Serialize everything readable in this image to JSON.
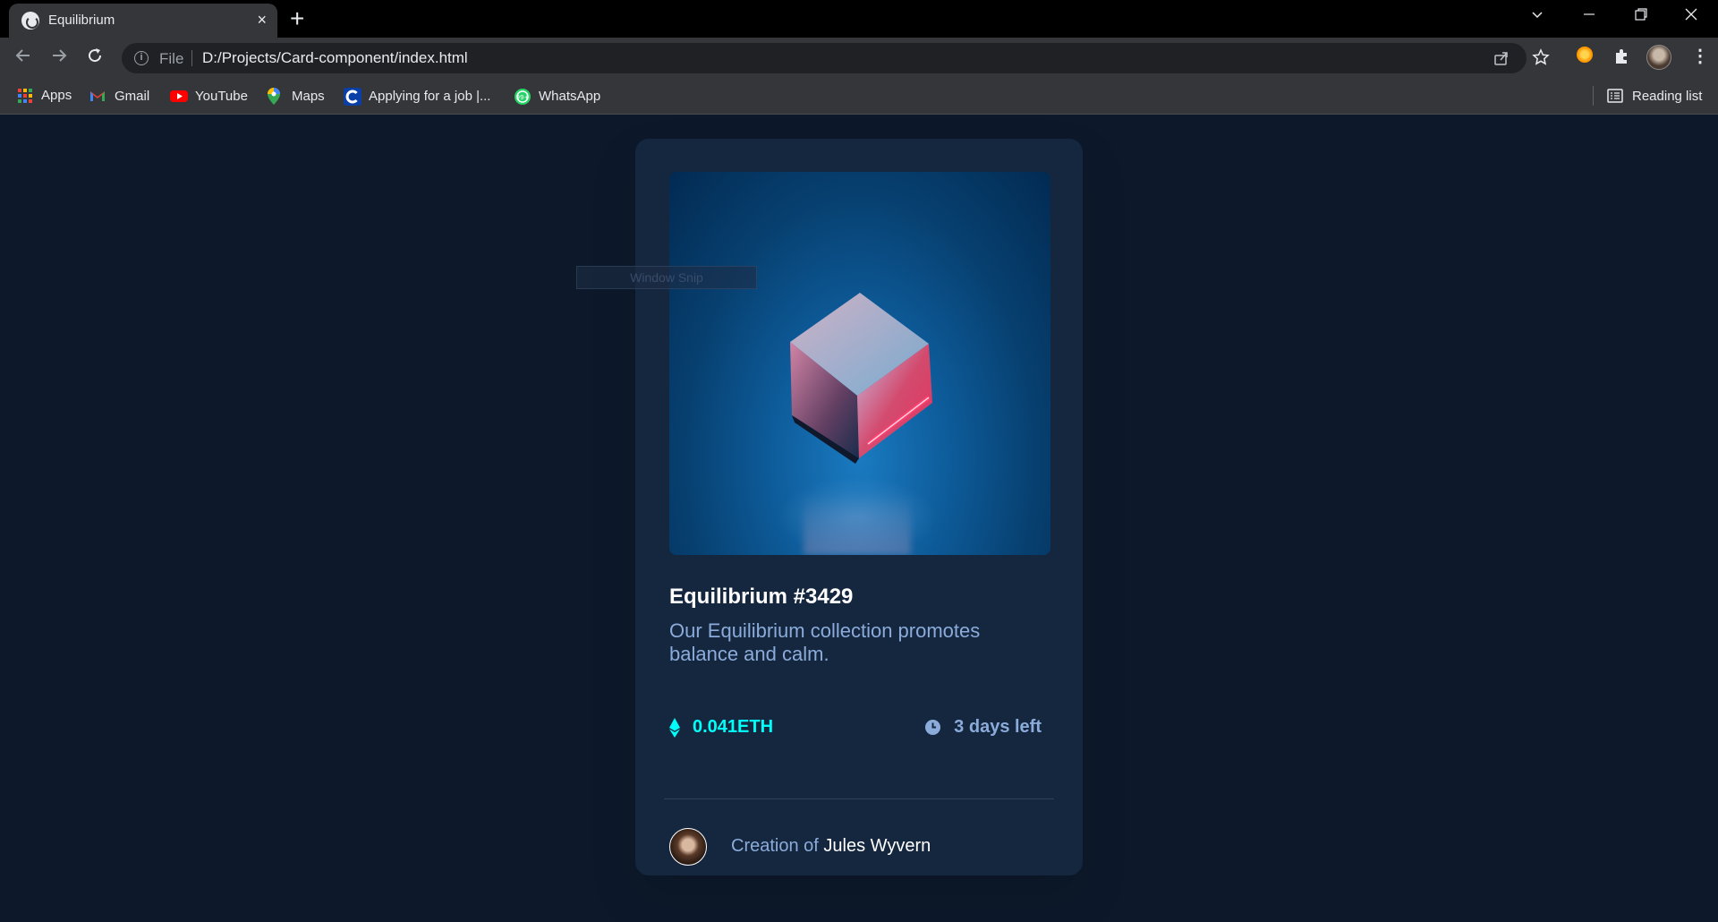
{
  "browser": {
    "tab_title": "Equilibrium",
    "tab_close": "×",
    "new_tab": "+",
    "url_scheme_label": "File",
    "url": "D:/Projects/Card-component/index.html",
    "reading_list": "Reading list",
    "bookmarks": [
      {
        "label": "Apps",
        "icon": "apps-grid-icon"
      },
      {
        "label": "Gmail",
        "icon": "gmail-icon"
      },
      {
        "label": "YouTube",
        "icon": "youtube-icon"
      },
      {
        "label": "Maps",
        "icon": "maps-icon"
      },
      {
        "label": "Applying for a job |...",
        "icon": "c-logo-icon"
      },
      {
        "label": "WhatsApp",
        "icon": "whatsapp-icon"
      }
    ]
  },
  "overlay": {
    "snip_label": "Window Snip"
  },
  "card": {
    "title": "Equilibrium #3429",
    "description": "Our Equilibrium collection promotes balance and calm.",
    "price": "0.041ETH",
    "time_left": "3 days left",
    "creation_prefix": "Creation of",
    "creator_name": "Jules Wyvern"
  },
  "colors": {
    "page_bg": "#0d192b",
    "card_bg": "#15263f",
    "cyan": "#00fff8",
    "soft_blue": "#8bacda",
    "white": "#ffffff"
  }
}
